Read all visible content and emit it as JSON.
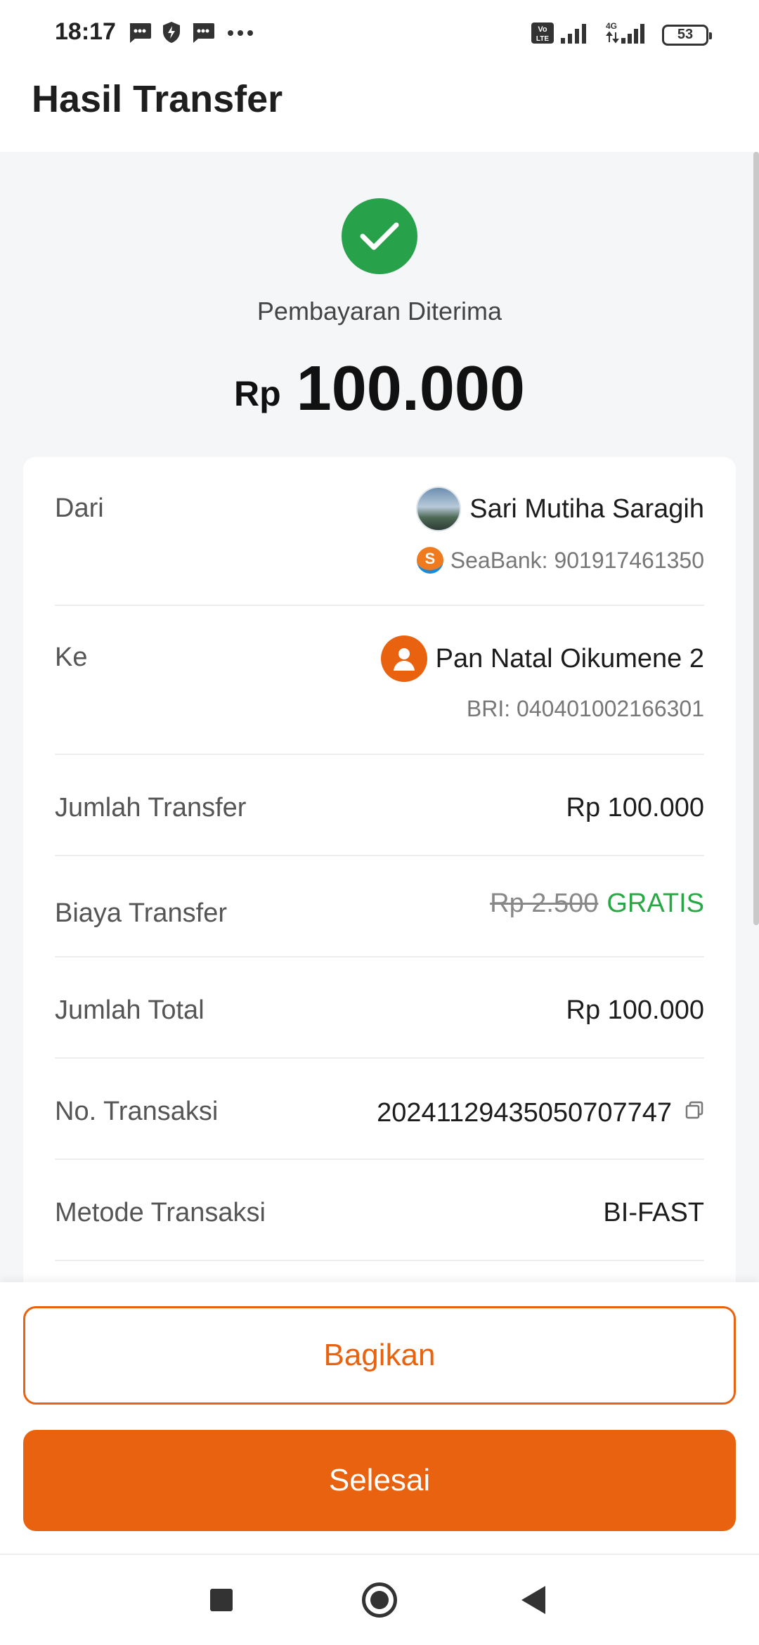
{
  "status_bar": {
    "time": "18:17",
    "notification_icons": [
      "message-icon",
      "shield-bolt-icon",
      "message-icon",
      "more-dots-icon"
    ],
    "network_label": "4G",
    "volte_label": "Vo LTE",
    "battery": "53"
  },
  "header": {
    "title": "Hasil Transfer"
  },
  "result": {
    "status": "Pembayaran Diterima",
    "currency": "Rp",
    "amount": "100.000",
    "status_color": "#27a14a"
  },
  "details": {
    "from": {
      "label": "Dari",
      "name": "Sari Mutiha Saragih",
      "account": "SeaBank: 901917461350"
    },
    "to": {
      "label": "Ke",
      "name": "Pan Natal Oikumene 2",
      "account": "BRI: 040401002166301"
    },
    "transfer_amount": {
      "label": "Jumlah Transfer",
      "value": "Rp 100.000"
    },
    "transfer_fee": {
      "label": "Biaya Transfer",
      "original": "Rp 2.500",
      "value": "GRATIS"
    },
    "total": {
      "label": "Jumlah Total",
      "value": "Rp 100.000"
    },
    "transaction_no": {
      "label": "No. Transaksi",
      "value": "20241129435050707747"
    },
    "method": {
      "label": "Metode Transaksi",
      "value": "BI-FAST"
    }
  },
  "actions": {
    "share_label": "Bagikan",
    "done_label": "Selesai",
    "accent_color": "#e8620f"
  }
}
